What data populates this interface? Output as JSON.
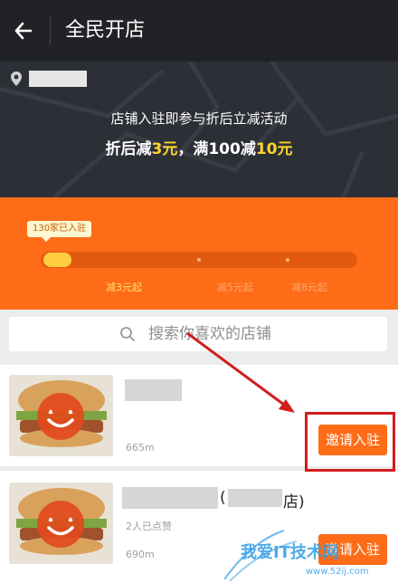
{
  "header": {
    "title": "全民开店",
    "back_icon": "back-arrow-icon"
  },
  "banner": {
    "line1": "店铺入驻即参与折后立减活动",
    "line2_a": "折后减",
    "line2_b": "3元",
    "line2_c": "，满100减",
    "line2_d": "10元"
  },
  "progress": {
    "bubble": "130家已入驻",
    "filled_fraction": 0.09,
    "steps": [
      "减3元起",
      "减5元起",
      "减8元起"
    ]
  },
  "search": {
    "placeholder": "搜索你喜欢的店铺"
  },
  "shops": [
    {
      "distance": "665m",
      "button": "邀请入驻"
    },
    {
      "suffix": "(",
      "suffix_end": "店)",
      "likes": "2人已点赞",
      "distance": "690m",
      "button": "邀请入驻"
    }
  ],
  "watermark": {
    "text": "我爱IT技术网",
    "url": "www.52ij.com"
  },
  "colors": {
    "brand_orange": "#ff6c18",
    "highlight_yellow": "#ffd42a",
    "annotation_red": "#d11d1d"
  }
}
